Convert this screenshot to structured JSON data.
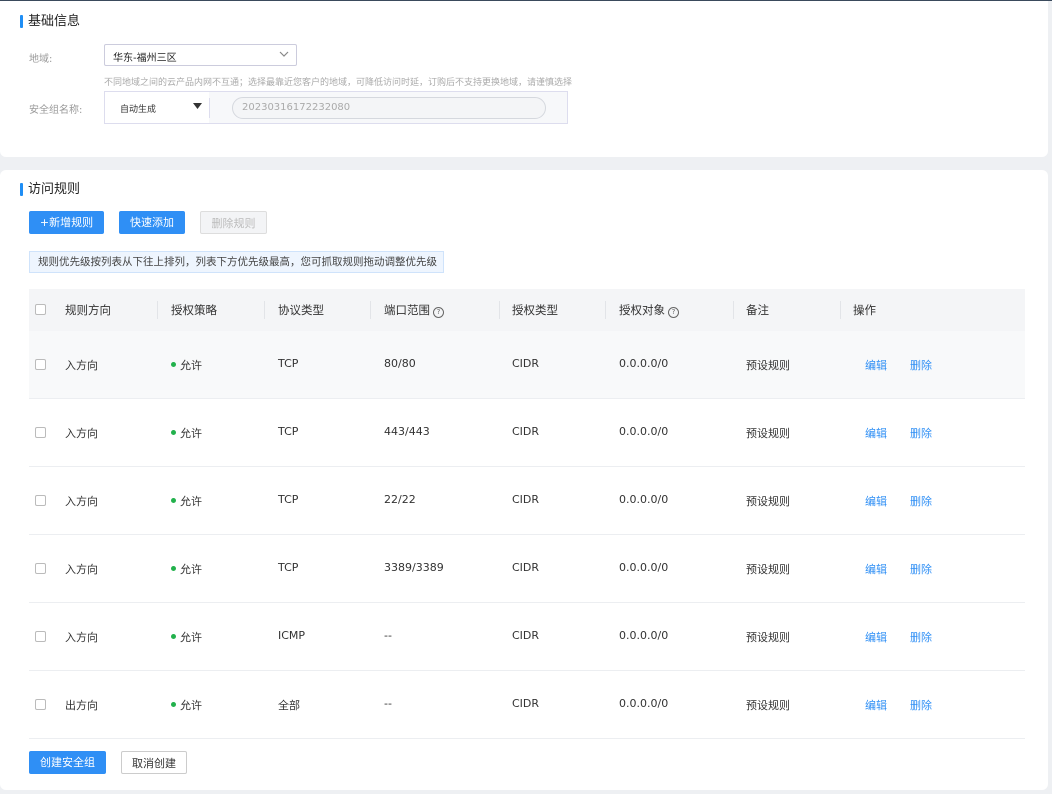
{
  "basic": {
    "title": "基础信息",
    "region_label": "地域:",
    "region_value": "华东-福州三区",
    "region_hint": "不同地域之间的云产品内网不互通；选择最靠近您客户的地域，可降低访问时延，订购后不支持更换地域，请谨慎选择",
    "name_label": "安全组名称:",
    "name_mode": "自动生成",
    "name_value": "20230316172232080"
  },
  "rules": {
    "title": "访问规则",
    "add_button": "+新增规则",
    "quick_add_button": "快速添加",
    "delete_button": "删除规则",
    "notice": "规则优先级按列表从下往上排列，列表下方优先级最高，您可抓取规则拖动调整优先级",
    "columns": [
      "规则方向",
      "授权策略",
      "协议类型",
      "端口范围",
      "授权类型",
      "授权对象",
      "备注",
      "操作"
    ],
    "help_glyph": "?",
    "rows": [
      {
        "direction": "入方向",
        "policy": "允许",
        "protocol": "TCP",
        "port": "80/80",
        "auth_type": "CIDR",
        "target": "0.0.0.0/0",
        "note": "预设规则",
        "edit": "编辑",
        "delete": "删除"
      },
      {
        "direction": "入方向",
        "policy": "允许",
        "protocol": "TCP",
        "port": "443/443",
        "auth_type": "CIDR",
        "target": "0.0.0.0/0",
        "note": "预设规则",
        "edit": "编辑",
        "delete": "删除"
      },
      {
        "direction": "入方向",
        "policy": "允许",
        "protocol": "TCP",
        "port": "22/22",
        "auth_type": "CIDR",
        "target": "0.0.0.0/0",
        "note": "预设规则",
        "edit": "编辑",
        "delete": "删除"
      },
      {
        "direction": "入方向",
        "policy": "允许",
        "protocol": "TCP",
        "port": "3389/3389",
        "auth_type": "CIDR",
        "target": "0.0.0.0/0",
        "note": "预设规则",
        "edit": "编辑",
        "delete": "删除"
      },
      {
        "direction": "入方向",
        "policy": "允许",
        "protocol": "ICMP",
        "port": "--",
        "auth_type": "CIDR",
        "target": "0.0.0.0/0",
        "note": "预设规则",
        "edit": "编辑",
        "delete": "删除"
      },
      {
        "direction": "出方向",
        "policy": "允许",
        "protocol": "全部",
        "port": "--",
        "auth_type": "CIDR",
        "target": "0.0.0.0/0",
        "note": "预设规则",
        "edit": "编辑",
        "delete": "删除"
      }
    ]
  },
  "footer": {
    "create_button": "创建安全组",
    "cancel_button": "取消创建"
  },
  "colors": {
    "accent": "#2f8ff5",
    "allow_dot": "#22b14c"
  }
}
